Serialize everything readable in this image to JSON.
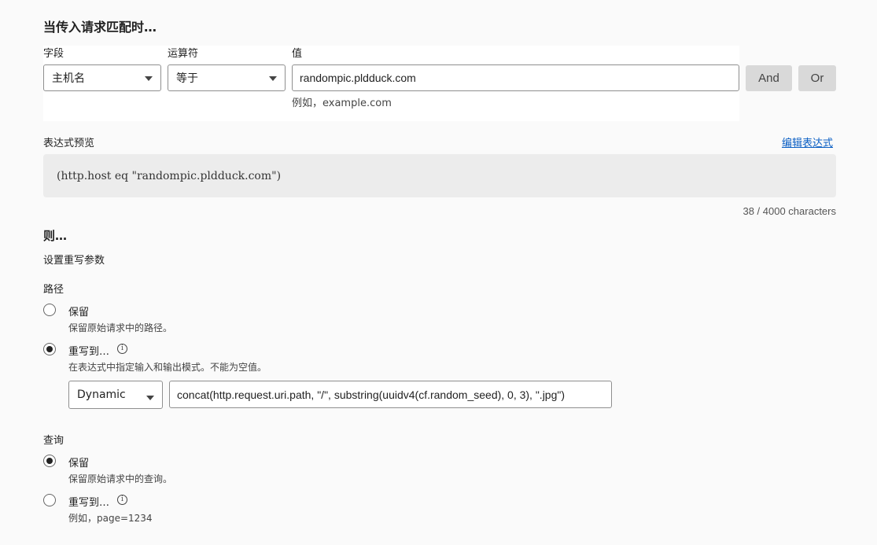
{
  "match_section": {
    "title": "当传入请求匹配时…",
    "field_label": "字段",
    "operator_label": "运算符",
    "value_label": "值",
    "field_value": "主机名",
    "operator_value": "等于",
    "value_input": "randompic.pldduck.com",
    "value_hint": "例如，example.com",
    "and_label": "And",
    "or_label": "Or"
  },
  "expression": {
    "label": "表达式预览",
    "edit_link": "编辑表达式",
    "code": "(http.host eq \"randompic.pldduck.com\")",
    "char_count": "38 / 4000 characters"
  },
  "then_section": {
    "title": "则…",
    "subtitle": "设置重写参数"
  },
  "path": {
    "label": "路径",
    "preserve_label": "保留",
    "preserve_desc": "保留原始请求中的路径。",
    "rewrite_label": "重写到…",
    "rewrite_desc": "在表达式中指定输入和输出模式。不能为空值。",
    "selected": "rewrite",
    "mode_value": "Dynamic",
    "expression_value": "concat(http.request.uri.path, \"/\", substring(uuidv4(cf.random_seed), 0, 3), \".jpg\")"
  },
  "query": {
    "label": "查询",
    "preserve_label": "保留",
    "preserve_desc": "保留原始请求中的查询。",
    "rewrite_label": "重写到…",
    "rewrite_desc": "例如，page=1234",
    "selected": "preserve"
  },
  "icons": {
    "info": "info-icon",
    "dropdown": "chevron-down-icon"
  },
  "colors": {
    "link": "#0b5fc4",
    "button_bg": "#d9d9d9",
    "code_bg": "#ececec"
  }
}
